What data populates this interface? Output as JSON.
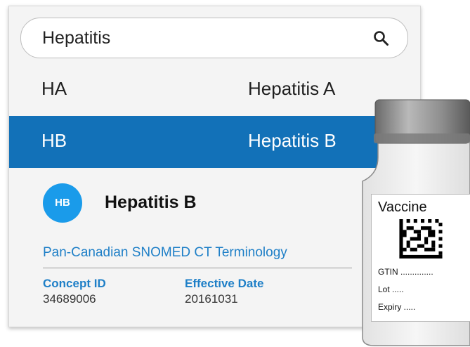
{
  "search": {
    "value": "Hepatitis",
    "icon": "search-icon"
  },
  "results": [
    {
      "code": "HA",
      "name": "Hepatitis A",
      "selected": false
    },
    {
      "code": "HB",
      "name": "Hepatitis B",
      "selected": true
    }
  ],
  "detail": {
    "badge": "HB",
    "title": "Hepatitis B",
    "terminology": "Pan-Canadian SNOMED CT Terminology",
    "concept_label": "Concept ID",
    "concept_value": "34689006",
    "effective_label": "Effective Date",
    "effective_value": "20161031"
  },
  "vial": {
    "title": "Vaccine",
    "gtin": "GTIN ..............",
    "lot": "Lot .....",
    "expiry": "Expiry ....."
  },
  "colors": {
    "selected_row": "#1271b8",
    "accent": "#1e7fc7",
    "badge": "#1a9bea"
  }
}
